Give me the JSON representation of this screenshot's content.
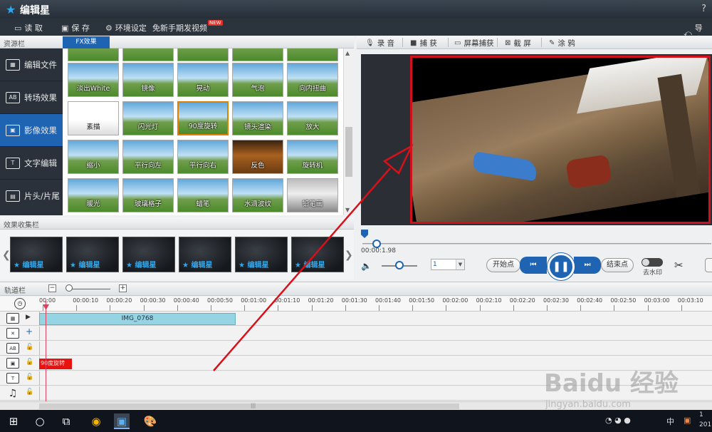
{
  "app": {
    "title": "编辑星",
    "help": "?"
  },
  "menu": {
    "read": "读 取",
    "save": "保 存",
    "env": "环境设定",
    "free": "免新手期发视频",
    "new_badge": "NEW",
    "extra": "导 出"
  },
  "resource": {
    "header": "资源栏",
    "tab": "FX效果",
    "nav": [
      {
        "label": "编辑文件",
        "icon": "film-icon"
      },
      {
        "label": "转场效果",
        "icon": "ab-transition-icon"
      },
      {
        "label": "影像效果",
        "icon": "image-effect-icon"
      },
      {
        "label": "文字编辑",
        "icon": "text-icon"
      },
      {
        "label": "片头/片尾",
        "icon": "title-icon"
      }
    ],
    "effects": [
      "淡出White",
      "镜像",
      "晃动",
      "气泡",
      "向内扭曲",
      "素描",
      "闪光灯",
      "90度旋转",
      "镜头渲染",
      "放大",
      "缩小",
      "平行向左",
      "平行向右",
      "反色",
      "旋转机",
      "暖光",
      "玻璃格子",
      "蜡笔",
      "水滴波纹",
      "铅笔画"
    ],
    "selected_effect": "90度旋转"
  },
  "collection": {
    "header": "效果收集栏",
    "logo": "编辑星",
    "count": 6
  },
  "capture": {
    "record": "录 音",
    "capture": "捕 获",
    "screen_capture": "屏幕捕获",
    "screenshot": "截 屏",
    "paint": "涂 鸦"
  },
  "player": {
    "time": "00:00:1.98",
    "speed": "1",
    "start_point": "开始点",
    "end_point": "结束点",
    "remove_watermark": "去水印",
    "progress": 0.04,
    "volume": 0.5
  },
  "timeline": {
    "header": "轨道栏",
    "zoom_out": "−",
    "zoom_in": "+",
    "ruler": [
      "00:00",
      "00:00:10",
      "00:00:20",
      "00:00:30",
      "00:00:40",
      "00:00:50",
      "00:01:00",
      "00:01:10",
      "00:01:20",
      "00:01:30",
      "00:01:40",
      "00:01:50",
      "00:02:00",
      "00:02:10",
      "00:02:20",
      "00:02:30",
      "00:02:40",
      "00:02:50",
      "00:03:00",
      "00:03:10"
    ],
    "video_clip": "IMG_0768",
    "fx_clip": "90度旋转"
  },
  "taskbar": {
    "lang": "中",
    "time": "1",
    "year_part": "201"
  },
  "watermark": {
    "brand": "Baidu 经验",
    "url": "jingyan.baidu.com"
  },
  "colors": {
    "accent": "#1f63b3",
    "highlight_border": "#d0101a",
    "annotation_arrow": "#d8101a",
    "fx_clip": "#e8120f",
    "video_clip": "#95d4e3"
  }
}
